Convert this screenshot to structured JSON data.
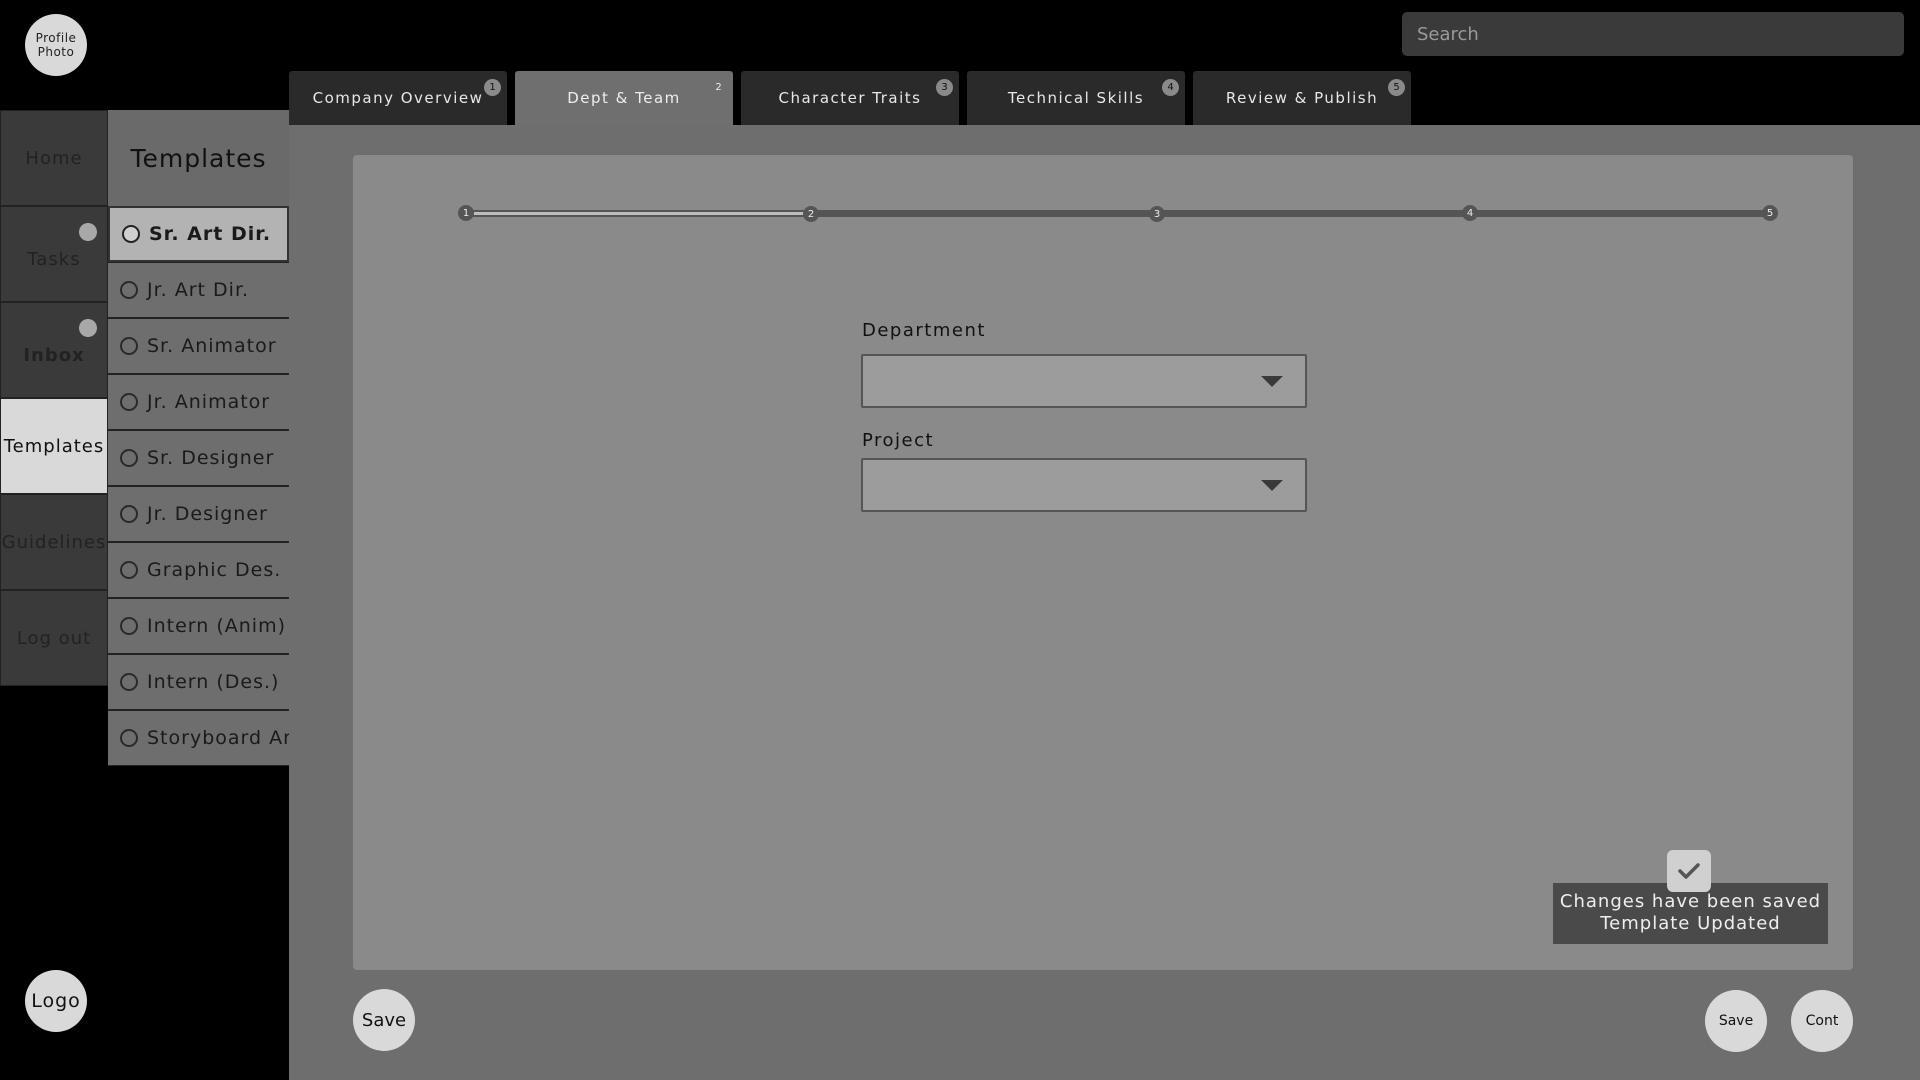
{
  "profile": {
    "label_line1": "Profile",
    "label_line2": "Photo"
  },
  "logo": {
    "label": "Logo"
  },
  "search": {
    "placeholder": "Search"
  },
  "nav": {
    "home": "Home",
    "tasks": "Tasks",
    "inbox": "Inbox",
    "templates": "Templates",
    "guidelines": "Guidelines",
    "logout": "Log out"
  },
  "templates": {
    "title": "Templates",
    "items": [
      {
        "label": "Sr. Art Dir.",
        "selected": true
      },
      {
        "label": "Jr. Art Dir."
      },
      {
        "label": "Sr. Animator"
      },
      {
        "label": "Jr. Animator"
      },
      {
        "label": "Sr. Designer"
      },
      {
        "label": "Jr. Designer"
      },
      {
        "label": "Graphic Des."
      },
      {
        "label": "Intern (Anim)"
      },
      {
        "label": "Intern (Des.)"
      },
      {
        "label": "Storyboard Art"
      }
    ]
  },
  "tabs": [
    {
      "label": "Company Overview",
      "num": "1"
    },
    {
      "label": "Dept & Team",
      "num": "2",
      "active": true
    },
    {
      "label": "Character Traits",
      "num": "3"
    },
    {
      "label": "Technical Skills",
      "num": "4"
    },
    {
      "label": "Review & Publish",
      "num": "5"
    }
  ],
  "stepper": {
    "steps": [
      "1",
      "2",
      "3",
      "4",
      "5"
    ],
    "current": 2
  },
  "form": {
    "department_label": "Department",
    "department_value": "",
    "project_label": "Project",
    "project_value": ""
  },
  "toast": {
    "line1": "Changes have been saved",
    "line2": "Template Updated"
  },
  "buttons": {
    "save_left": "Save",
    "save_right": "Save",
    "continue": "Cont"
  }
}
